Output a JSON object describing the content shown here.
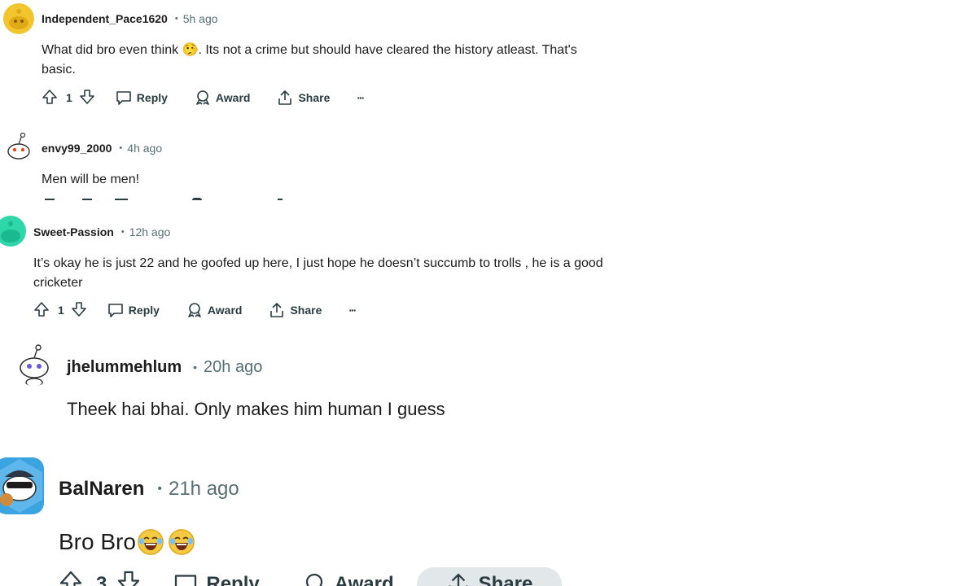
{
  "comments": [
    {
      "username": "Independent_Pace1620",
      "separator": "•",
      "time": "5h ago",
      "text_before": "What did bro even think ",
      "emoji": "🤥",
      "text_after": ". Its not a crime but should have cleared the history atleast. That's basic.",
      "votes": "1",
      "reply": "Reply",
      "award": "Award",
      "share": "Share",
      "more": "···"
    },
    {
      "username": "envy99_2000",
      "separator": "•",
      "time": "4h ago",
      "text": "Men will be men!"
    },
    {
      "username": "Sweet-Passion",
      "separator": "•",
      "time": "12h ago",
      "text": "It’s okay he is just 22 and he goofed up here, I just hope he doesn’t succumb to trolls , he is a good cricketer",
      "votes": "1",
      "reply": "Reply",
      "award": "Award",
      "share": "Share",
      "more": "···"
    },
    {
      "username": "jhelummehlum",
      "separator": "•",
      "time": "20h ago",
      "text": "Theek hai bhai. Only makes him human I guess"
    },
    {
      "username": "BalNaren",
      "separator": "•",
      "time": "21h ago",
      "text": "Bro Bro",
      "votes": "3",
      "reply": "Reply",
      "award": "Award",
      "share": "Share"
    }
  ],
  "colors": {
    "text": "#1c1c1c",
    "meta": "#576f76",
    "action": "#2a3c42",
    "share_pill": "#e2e7e9",
    "avatar_yellow": "#f2c52f",
    "avatar_teal": "#2ed6a8"
  },
  "icons": [
    "upvote-icon",
    "downvote-icon",
    "reply-icon",
    "award-icon",
    "share-icon",
    "more-icon",
    "laughing-emoji-icon",
    "lying-face-emoji-icon"
  ]
}
